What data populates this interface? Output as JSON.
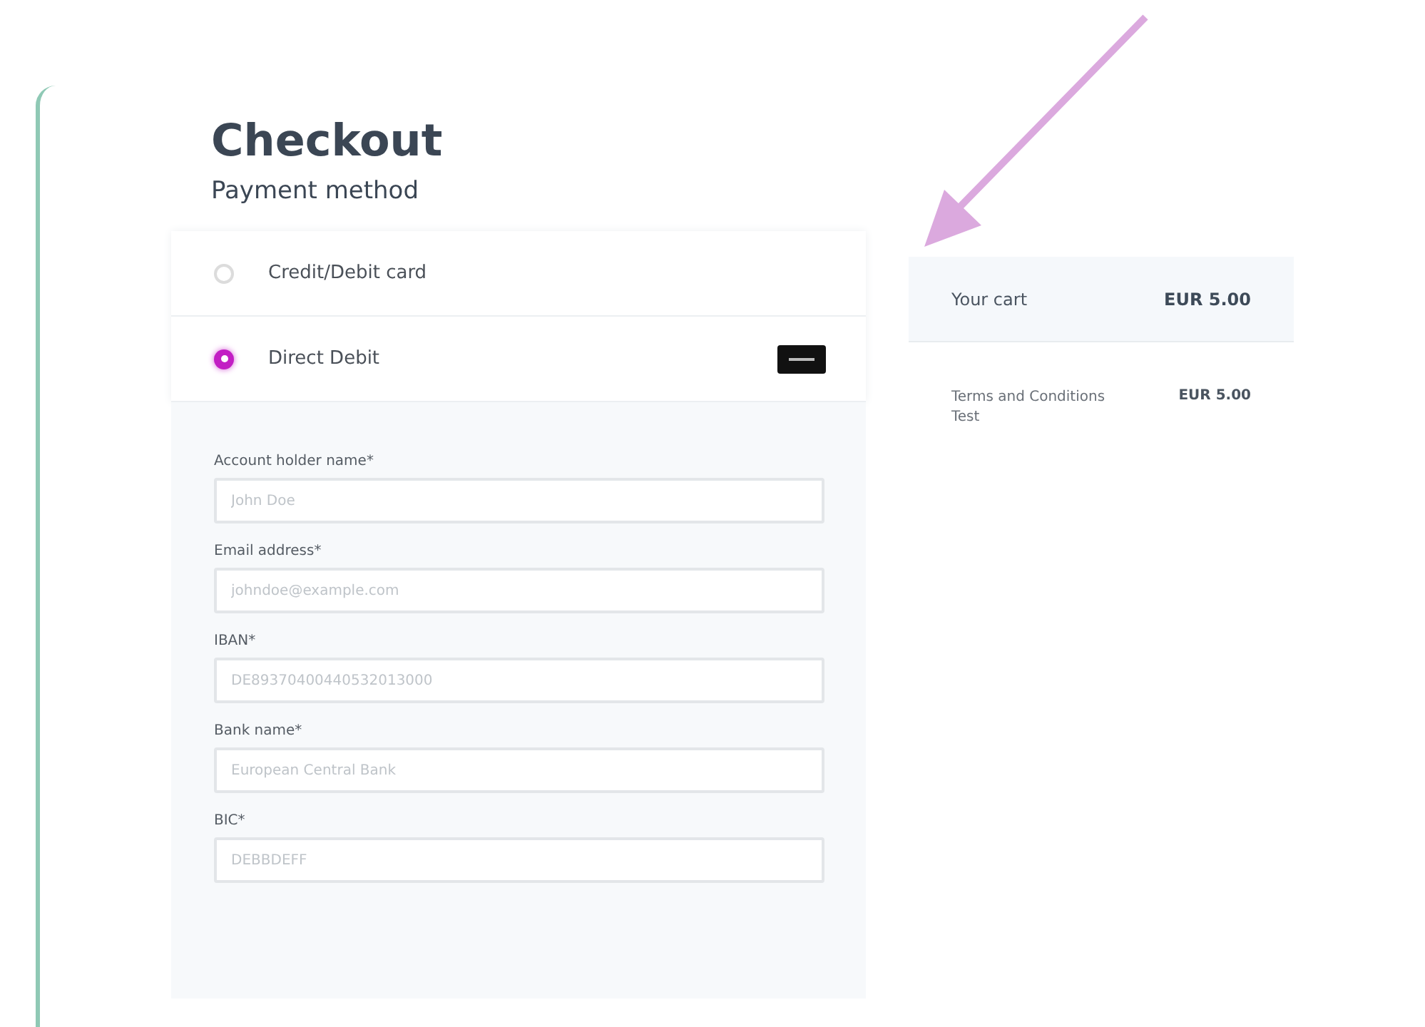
{
  "heading": "Checkout",
  "subheading": "Payment method",
  "payment_methods": [
    {
      "label": "Credit/Debit card",
      "selected": false,
      "has_logo": false
    },
    {
      "label": "Direct Debit",
      "selected": true,
      "has_logo": true
    }
  ],
  "fields": [
    {
      "label": "Account holder name*",
      "placeholder": "John Doe"
    },
    {
      "label": "Email address*",
      "placeholder": "johndoe@example.com"
    },
    {
      "label": "IBAN*",
      "placeholder": "DE89370400440532013000"
    },
    {
      "label": "Bank name*",
      "placeholder": "European Central Bank"
    },
    {
      "label": "BIC*",
      "placeholder": "DEBBDEFF"
    }
  ],
  "cart": {
    "title": "Your cart",
    "total": "EUR 5.00",
    "items": [
      {
        "name": "Terms and Conditions Test",
        "price": "EUR 5.00"
      }
    ]
  }
}
